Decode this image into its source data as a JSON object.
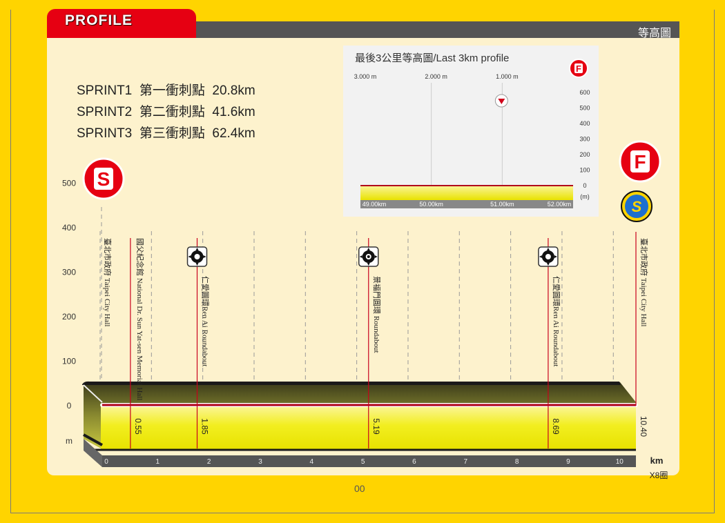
{
  "header": {
    "tab_label": "PROFILE",
    "right_label": "等高圖"
  },
  "sprints": [
    {
      "label": "SPRINT1",
      "name": "第一衝刺點",
      "km": "20.8km"
    },
    {
      "label": "SPRINT2",
      "name": "第二衝刺點",
      "km": "41.6km"
    },
    {
      "label": "SPRINT3",
      "name": "第三衝刺點",
      "km": "62.4km"
    }
  ],
  "page_number": "00",
  "colors": {
    "background": "#ffd400",
    "accent": "#e60012",
    "panel": "#fdf2cd",
    "header": "#555555"
  },
  "chart_data": [
    {
      "type": "area",
      "title": "",
      "xlabel": "km",
      "xnote": "X8圈",
      "ylabel": "m",
      "xlim": [
        0,
        10.4
      ],
      "ylim": [
        0,
        500
      ],
      "x_ticks": [
        "0",
        "1",
        "2",
        "3",
        "4",
        "5",
        "6",
        "7",
        "8",
        "9",
        "10"
      ],
      "y_ticks": [
        "0",
        "100",
        "200",
        "300",
        "400",
        "500"
      ],
      "grid": "vertical dashed",
      "series": [
        {
          "x": [
            0,
            10.4
          ],
          "y": [
            0,
            0
          ]
        }
      ],
      "start_icon": "start-s-icon",
      "finish_icon": "finish-f-icon",
      "sprint_icon": "sprint-s-icon",
      "waypoints": [
        {
          "km_label": "",
          "name": "臺北市政府 Taipei City Hall",
          "x": 0,
          "icon": ""
        },
        {
          "km_label": "0.55",
          "name": "國父紀念館 National Dr. Sun Yat-sen Memorial Hall",
          "x": 0.55,
          "icon": ""
        },
        {
          "km_label": "1.85",
          "name": "仁愛圓環Ren Ai Roundabout",
          "x": 1.85,
          "icon": "roundabout-icon"
        },
        {
          "km_label": "5.19",
          "name": "景福門圓環 Roundabout",
          "x": 5.19,
          "icon": "roundabout-gate-icon"
        },
        {
          "km_label": "8.69",
          "name": "仁愛圓環Ren Ai Roundabout",
          "x": 8.69,
          "icon": "roundabout-icon"
        },
        {
          "km_label": "10.40",
          "name": "臺北市政府 Taipei City Hall",
          "x": 10.4,
          "icon": ""
        }
      ]
    },
    {
      "type": "area",
      "title": "最後3公里等高圖/Last 3km profile",
      "ylabel": "(m)",
      "xlim": [
        49.0,
        52.0
      ],
      "ylim": [
        0,
        600
      ],
      "x_ticks": [
        "49.00km",
        "50.00km",
        "51.00km",
        "52.00km"
      ],
      "top_ticks": [
        "3.000 m",
        "2.000 m",
        "1.000 m"
      ],
      "y_ticks": [
        "0",
        "100",
        "200",
        "300",
        "400",
        "500",
        "600"
      ],
      "series": [
        {
          "x": [
            49.0,
            52.0
          ],
          "y": [
            0,
            0
          ]
        }
      ],
      "finish_icon": "finish-f-icon",
      "marker_icon": "flamme-rouge-icon",
      "marker_x": 51.0
    }
  ]
}
